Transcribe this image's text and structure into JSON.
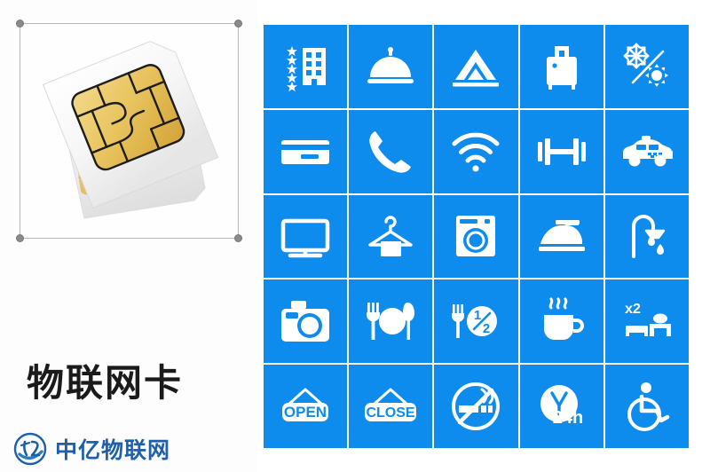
{
  "left_panel": {
    "caption_title": "物联网卡",
    "brand_text": "中亿物联网",
    "brand_mark_name": "zhongyi-circular-logo-icon",
    "artwork_name": "sim-card-pair-illustration",
    "selection": {
      "handles": [
        "top-left",
        "top-right",
        "bottom-left",
        "bottom-right"
      ]
    }
  },
  "colors": {
    "tile_blue": "#0e8ced",
    "tile_icon": "#ffffff",
    "panel_background": "#fdfdfe",
    "page_background": "#ffffff",
    "caption_color": "#1a1a1a",
    "brand_color": "#1d5fa8",
    "selection_border": "#b9b9b9",
    "handle_color": "#8a8a8a",
    "sim_gold": "#e8bc4e",
    "sim_white": "#f4f4f4"
  },
  "icon_grid": {
    "rows": 5,
    "columns": 5,
    "tiles": [
      {
        "name": "hotel-stars-icon",
        "label": "Hotel (star rated)"
      },
      {
        "name": "room-service-bell-icon",
        "label": "Room service"
      },
      {
        "name": "tent-camping-icon",
        "label": "Camping / tent"
      },
      {
        "name": "luggage-suitcase-icon",
        "label": "Luggage"
      },
      {
        "name": "air-conditioning-icon",
        "label": "Air conditioning"
      },
      {
        "name": "credit-card-icon",
        "label": "Credit card accepted"
      },
      {
        "name": "telephone-icon",
        "label": "Telephone"
      },
      {
        "name": "wifi-icon",
        "label": "Wi-Fi"
      },
      {
        "name": "dumbbell-gym-icon",
        "label": "Gym / fitness"
      },
      {
        "name": "taxi-icon",
        "label": "Taxi"
      },
      {
        "name": "television-icon",
        "label": "Television"
      },
      {
        "name": "clothes-hanger-icon",
        "label": "Laundry / hanger"
      },
      {
        "name": "washing-machine-icon",
        "label": "Washing machine"
      },
      {
        "name": "iron-icon",
        "label": "Ironing"
      },
      {
        "name": "shower-icon",
        "label": "Shower"
      },
      {
        "name": "camera-icon",
        "label": "Camera"
      },
      {
        "name": "restaurant-icon",
        "label": "Restaurant"
      },
      {
        "name": "half-board-icon",
        "label": "Half board",
        "text": "1/2"
      },
      {
        "name": "coffee-cup-icon",
        "label": "Coffee / breakfast"
      },
      {
        "name": "double-bed-icon",
        "label": "Double bed",
        "text": "x2"
      },
      {
        "name": "open-sign-icon",
        "label": "Open",
        "text": "OPEN"
      },
      {
        "name": "close-sign-icon",
        "label": "Close",
        "text": "CLOSE"
      },
      {
        "name": "no-smoking-icon",
        "label": "No smoking"
      },
      {
        "name": "24-hour-clock-icon",
        "label": "24 hour service",
        "text": "24h"
      },
      {
        "name": "wheelchair-access-icon",
        "label": "Wheelchair accessible"
      }
    ]
  }
}
